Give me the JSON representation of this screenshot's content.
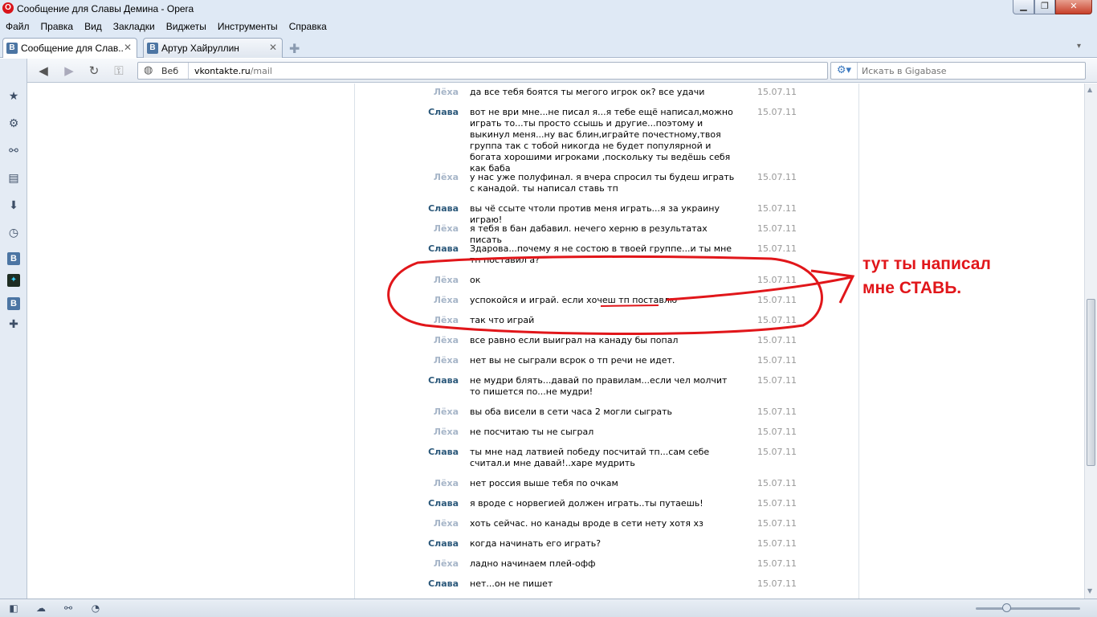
{
  "window": {
    "title": "Сообщение для Славы Демина - Opera",
    "logo_glyph": "O",
    "min_glyph": "▁",
    "max_glyph": "❐",
    "close_glyph": "✕"
  },
  "menu": [
    "Файл",
    "Правка",
    "Вид",
    "Закладки",
    "Виджеты",
    "Инструменты",
    "Справка"
  ],
  "tabs": [
    {
      "label": "Сообщение для Слав...",
      "active": true,
      "favicon": "В"
    },
    {
      "label": "Артур Хайруллин",
      "active": false,
      "favicon": "В"
    }
  ],
  "tab_controls": {
    "close_glyph": "✕",
    "new_tab_glyph": "✚",
    "tab_menu_glyph": "▾"
  },
  "nav": {
    "back_glyph": "◀",
    "forward_glyph": "▶",
    "reload_glyph": "↻",
    "key_glyph": "⚿"
  },
  "address": {
    "scope": "Веб",
    "domain": "vkontakte.ru",
    "path": "/mail",
    "globe_glyph": "◍"
  },
  "search": {
    "placeholder": "Искать в Gigabase",
    "engine_glyph": "⚙▾"
  },
  "sidepanel": {
    "icons": [
      "star-icon",
      "gear-icon",
      "share-icon",
      "notes-icon",
      "download-icon",
      "history-icon",
      "vk-icon",
      "game-icon",
      "vk-icon",
      "add-icon"
    ],
    "glyphs": {
      "star": "★",
      "gear": "⚙",
      "share": "⚯",
      "notes": "▤",
      "download": "⬇",
      "history": "◷",
      "vk": "В",
      "game": "✦",
      "add": "✚"
    }
  },
  "messages": [
    {
      "from": "Лёха",
      "text": "да все тебя боятся ты мегого игрок ок? все удачи",
      "date": "15.07.11"
    },
    {
      "from": "Слава",
      "text": "вот не ври мне...не писал я...я тебе ещё написал,можно играть то...ты просто ссышь и другие...поэтому и выкинул меня...ну вас блин,играйте почестному,твоя группа так с тобой никогда не будет популярной и богата хорошими игроками ,поскольку ты ведёшь себя как баба",
      "date": "15.07.11"
    },
    {
      "from": "Лёха",
      "text": "у нас уже полуфинал. я вчера спросил ты будеш играть с канадой. ты написал ставь тп",
      "date": "15.07.11"
    },
    {
      "from": "Слава",
      "text": "вы чё ссыте чтоли против меня играть...я за украину играю!",
      "date": "15.07.11"
    },
    {
      "from": "Лёха",
      "text": "я тебя в бан дабавил. нечего херню в результатах писать",
      "date": "15.07.11"
    },
    {
      "from": "Слава",
      "text": "Здарова...почему я не состою в твоей группе...и ты мне тп поставил а?",
      "date": "15.07.11"
    },
    {
      "from": "Лёха",
      "text": "ок",
      "date": "15.07.11"
    },
    {
      "from": "Лёха",
      "text": "успокойся и играй. если хочеш тп поставлю",
      "date": "15.07.11"
    },
    {
      "from": "Лёха",
      "text": "так что играй",
      "date": "15.07.11"
    },
    {
      "from": "Лёха",
      "text": "все равно если выиграл на канаду бы попал",
      "date": "15.07.11"
    },
    {
      "from": "Лёха",
      "text": "нет вы не сыграли всрок о тп речи не идет.",
      "date": "15.07.11"
    },
    {
      "from": "Слава",
      "text": "не мудри блять...давай по правилам...если чел молчит то пишется по...не мудри!",
      "date": "15.07.11"
    },
    {
      "from": "Лёха",
      "text": "вы оба висели в сети часа 2 могли сыграть",
      "date": "15.07.11"
    },
    {
      "from": "Лёха",
      "text": "не посчитаю ты не сыграл",
      "date": "15.07.11"
    },
    {
      "from": "Слава",
      "text": "ты мне над латвией победу посчитай тп...сам себе считал.и мне давай!..харе мудрить",
      "date": "15.07.11"
    },
    {
      "from": "Лёха",
      "text": "нет россия выше тебя по очкам",
      "date": "15.07.11"
    },
    {
      "from": "Слава",
      "text": "я вроде с норвегией должен играть..ты путаешь!",
      "date": "15.07.11"
    },
    {
      "from": "Лёха",
      "text": "хоть сейчас. но канады вроде в сети нету хотя хз",
      "date": "15.07.11"
    },
    {
      "from": "Слава",
      "text": "когда начинать его играть?",
      "date": "15.07.11"
    },
    {
      "from": "Лёха",
      "text": "ладно начинаем плей-офф",
      "date": "15.07.11"
    },
    {
      "from": "Слава",
      "text": "нет...он не пишет",
      "date": "15.07.11"
    }
  ],
  "annotation": {
    "text": "тут ты написал\nмне СТАВЬ.",
    "color": "#e1161a"
  },
  "statusbar": {
    "icons": [
      "panel-toggle-icon",
      "cloud-icon",
      "unite-icon",
      "speed-icon"
    ],
    "glyphs": [
      "◧",
      "☁",
      "⚯",
      "◔"
    ],
    "zoom": 0.3
  },
  "scrollbar": {
    "up_glyph": "▲",
    "down_glyph": "▼"
  },
  "colors": {
    "leha": "#a6b5c8",
    "slava": "#2b587a",
    "date": "#999999",
    "chrome": "#dfe9f5"
  }
}
